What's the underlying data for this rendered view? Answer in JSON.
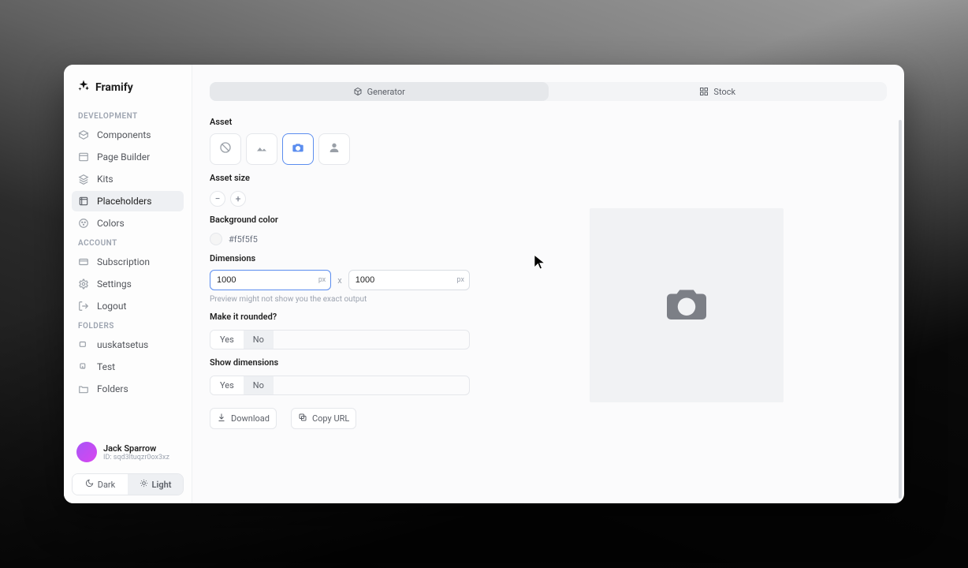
{
  "brand": {
    "name": "Framify"
  },
  "sidebar": {
    "sections": {
      "development": "DEVELOPMENT",
      "account": "ACCOUNT",
      "folders": "FOLDERS"
    },
    "development_items": [
      {
        "label": "Components"
      },
      {
        "label": "Page Builder"
      },
      {
        "label": "Kits"
      },
      {
        "label": "Placeholders"
      },
      {
        "label": "Colors"
      }
    ],
    "account_items": [
      {
        "label": "Subscription"
      },
      {
        "label": "Settings"
      },
      {
        "label": "Logout"
      }
    ],
    "folder_items": [
      {
        "label": "uuskatsetus"
      },
      {
        "label": "Test"
      },
      {
        "label": "Folders"
      }
    ]
  },
  "user": {
    "name": "Jack Sparrow",
    "id_label": "ID: sqd3ltuqzr0ox3xz"
  },
  "theme": {
    "dark": "Dark",
    "light": "Light"
  },
  "tabs": {
    "generator": "Generator",
    "stock": "Stock"
  },
  "form": {
    "asset_label": "Asset",
    "asset_size_label": "Asset size",
    "bg_label": "Background color",
    "bg_hex": "#f5f5f5",
    "dimensions_label": "Dimensions",
    "width_value": "1000",
    "height_value": "1000",
    "unit": "px",
    "separator": "x",
    "hint": "Preview might not show you the exact output",
    "rounded_label": "Make it rounded?",
    "show_dims_label": "Show dimensions",
    "yes": "Yes",
    "no": "No",
    "download": "Download",
    "copy_url": "Copy URL"
  },
  "colors": {
    "accent": "#5b8def",
    "panel": "#f1f2f4"
  }
}
